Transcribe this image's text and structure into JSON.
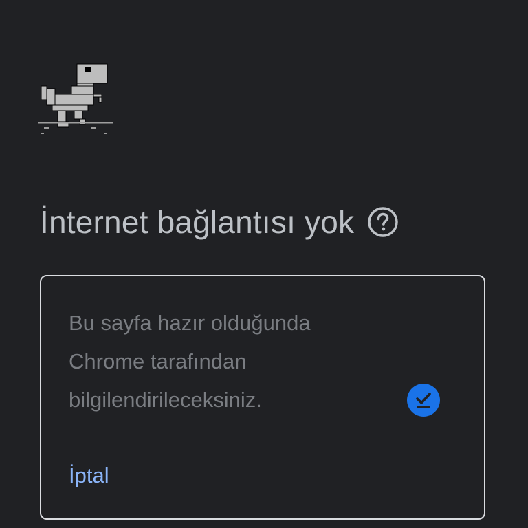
{
  "error": {
    "title": "İnternet bağlantısı yok",
    "dino_icon": "offline-dino-icon",
    "help_icon": "help-circle-icon"
  },
  "notify_card": {
    "message": "Bu sayfa hazır olduğunda Chrome tarafından bilgilendirileceksiniz.",
    "cancel_label": "İptal",
    "status_icon": "download-check-icon",
    "accent_color": "#1a73e8"
  },
  "colors": {
    "background": "#202124",
    "heading": "#bdc1c6",
    "link": "#8ab4f8"
  }
}
